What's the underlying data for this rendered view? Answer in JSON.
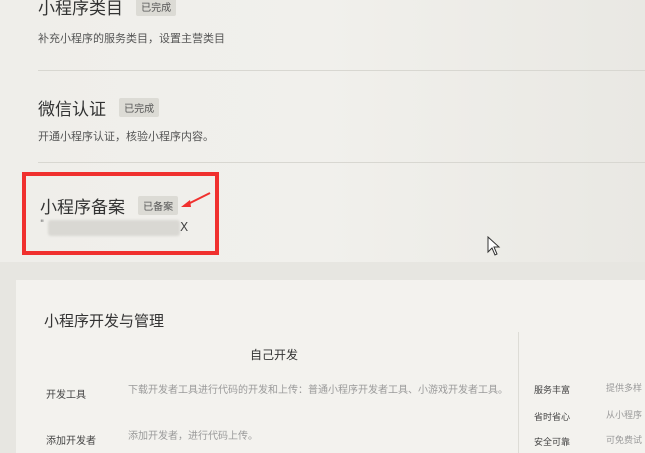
{
  "sections": {
    "category": {
      "title": "小程序类目",
      "badge": "已完成",
      "desc": "补充小程序的服务类目，设置主营类目"
    },
    "verify": {
      "title": "微信认证",
      "badge": "已完成",
      "desc": "开通小程序认证，核验小程序内容。"
    },
    "filing": {
      "title": "小程序备案",
      "badge": "已备案",
      "prefix": "\"",
      "suffix": "X"
    }
  },
  "dev": {
    "title": "小程序开发与管理",
    "center_label": "自己开发",
    "rows": [
      {
        "label": "开发工具",
        "desc": "下载开发者工具进行代码的开发和上传：普通小程序开发者工具、小游戏开发者工具。"
      },
      {
        "label": "添加开发者",
        "desc": "添加开发者，进行代码上传。"
      }
    ],
    "right": [
      {
        "label": "服务丰富",
        "desc": "提供多样"
      },
      {
        "label": "省时省心",
        "desc": "从小程序"
      },
      {
        "label": "安全可靠",
        "desc": "可免费试"
      }
    ]
  },
  "colors": {
    "highlight": "#f0302e"
  }
}
